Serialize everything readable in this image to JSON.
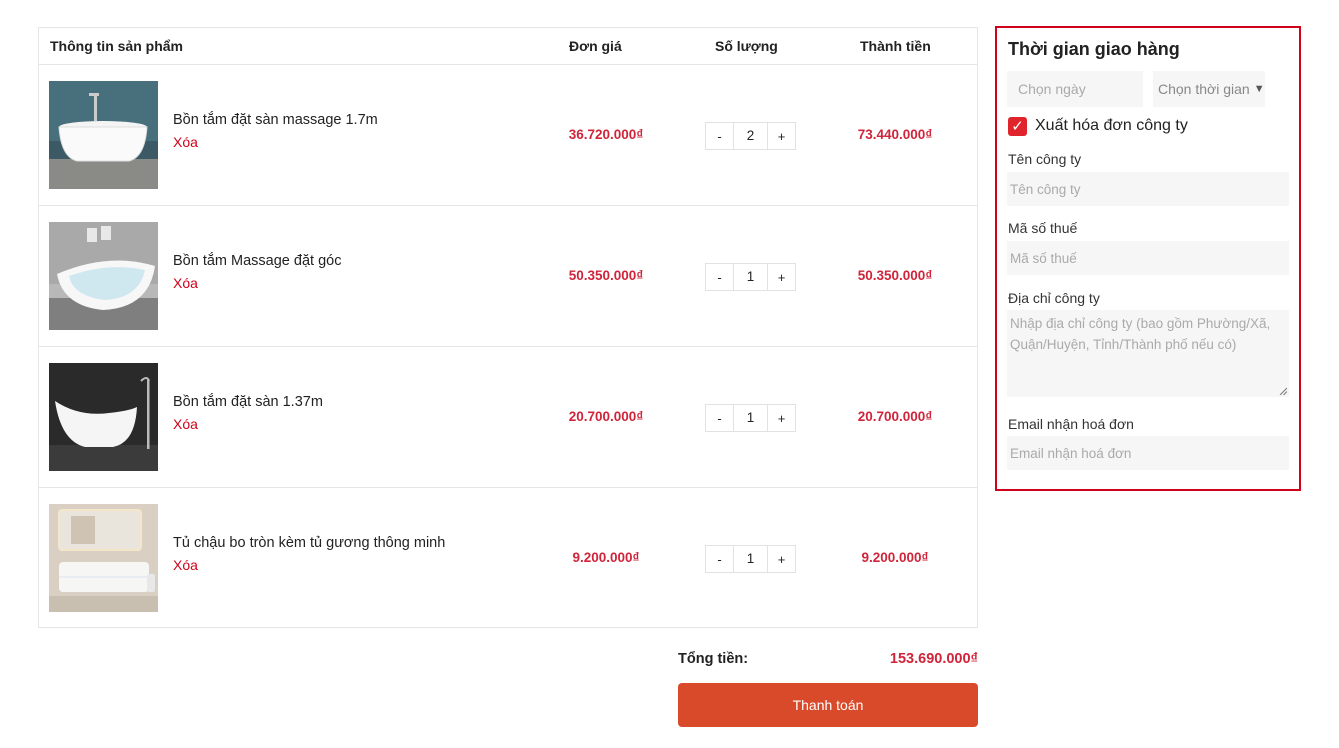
{
  "cart": {
    "headers": {
      "info": "Thông tin sản phẩm",
      "price": "Đơn giá",
      "qty": "Số lượng",
      "total": "Thành tiền"
    },
    "remove_label": "Xóa",
    "items": [
      {
        "name": "Bồn tắm đặt sàn massage 1.7m",
        "price": "36.720.000₫",
        "qty": "2",
        "total": "73.440.000₫",
        "image": "freestanding-oval-bathtub-image"
      },
      {
        "name": "Bồn tắm Massage đặt góc",
        "price": "50.350.000₫",
        "qty": "1",
        "total": "50.350.000₫",
        "image": "corner-massage-bathtub-image"
      },
      {
        "name": "Bồn tắm đặt sàn 1.37m",
        "price": "20.700.000₫",
        "qty": "1",
        "total": "20.700.000₫",
        "image": "slipper-bathtub-image"
      },
      {
        "name": "Tủ chậu bo tròn kèm tủ gương thông minh",
        "price": "9.200.000₫",
        "qty": "1",
        "total": "9.200.000₫",
        "image": "vanity-cabinet-mirror-image"
      }
    ],
    "minus_label": "-",
    "plus_label": "+"
  },
  "summary": {
    "total_label": "Tổng tiền:",
    "total_value": "153.690.000₫",
    "pay_label": "Thanh toán"
  },
  "delivery": {
    "title": "Thời gian giao hàng",
    "date_placeholder": "Chọn ngày",
    "time_selected": "Chọn thời gian",
    "invoice_checked": true,
    "invoice_label": "Xuất hóa đơn công ty",
    "company_name_label": "Tên công ty",
    "company_name_placeholder": "Tên công ty",
    "tax_code_label": "Mã số thuế",
    "tax_code_placeholder": "Mã số thuế",
    "address_label": "Địa chỉ công ty",
    "address_placeholder": "Nhập địa chỉ công ty (bao gồm Phường/Xã, Quận/Huyện, Tỉnh/Thành phố nếu có)",
    "email_label": "Email nhận hoá đơn",
    "email_placeholder": "Email nhận hoá đơn"
  },
  "colors": {
    "accent_red": "#d0243a",
    "pay_button": "#d94a2a",
    "panel_border": "#d0021b"
  }
}
